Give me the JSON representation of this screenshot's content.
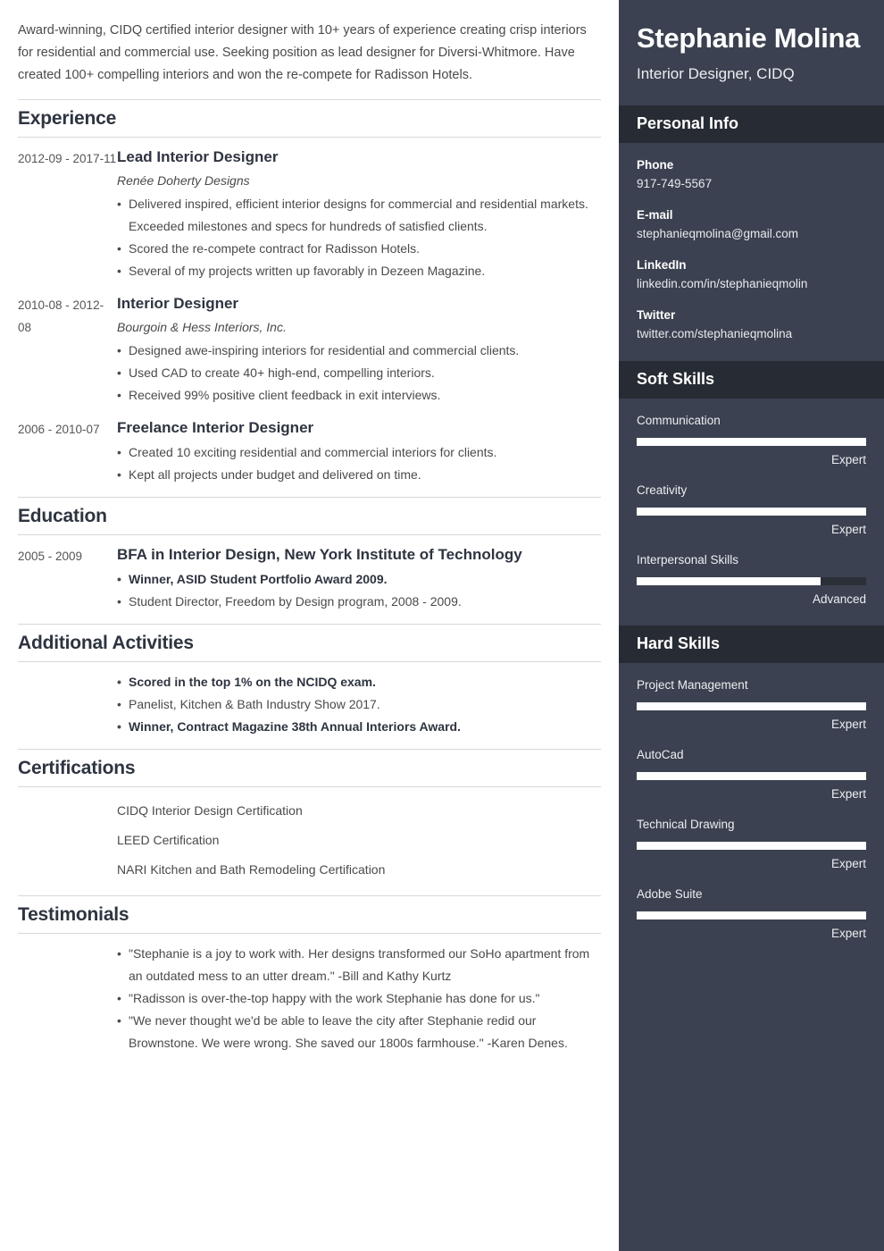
{
  "summary": "Award-winning, CIDQ certified interior designer with 10+ years of experience creating crisp interiors for residential and commercial use. Seeking position as lead designer for Diversi-Whitmore. Have created 100+ compelling interiors and won the re-compete for Radisson Hotels.",
  "sections": {
    "experience": {
      "heading": "Experience",
      "entries": [
        {
          "dates": "2012-09 - 2017-11",
          "title": "Lead Interior Designer",
          "company": "Renée Doherty Designs",
          "bullets": [
            {
              "text": "Delivered inspired, efficient interior designs for commercial and residential markets. Exceeded milestones and specs for hundreds of satisfied clients.",
              "bold": false
            },
            {
              "text": "Scored the re-compete contract for Radisson Hotels.",
              "bold": false
            },
            {
              "text": "Several of my projects written up favorably in Dezeen Magazine.",
              "bold": false
            }
          ]
        },
        {
          "dates": "2010-08 - 2012-08",
          "title": "Interior Designer",
          "company": "Bourgoin & Hess Interiors, Inc.",
          "bullets": [
            {
              "text": "Designed awe-inspiring interiors for residential and commercial clients.",
              "bold": false
            },
            {
              "text": "Used CAD to create 40+ high-end, compelling interiors.",
              "bold": false
            },
            {
              "text": "Received 99% positive client feedback in exit interviews.",
              "bold": false
            }
          ]
        },
        {
          "dates": "2006 - 2010-07",
          "title": "Freelance Interior Designer",
          "company": "",
          "bullets": [
            {
              "text": "Created 10 exciting residential and commercial interiors for clients.",
              "bold": false
            },
            {
              "text": "Kept all projects under budget and delivered on time.",
              "bold": false
            }
          ]
        }
      ]
    },
    "education": {
      "heading": "Education",
      "entries": [
        {
          "dates": "2005 - 2009",
          "title": "BFA in Interior Design, New York Institute of Technology",
          "company": "",
          "bullets": [
            {
              "text": "Winner, ASID Student Portfolio Award 2009.",
              "bold": true
            },
            {
              "text": "Student Director, Freedom by Design program, 2008 - 2009.",
              "bold": false
            }
          ]
        }
      ]
    },
    "additional_activities": {
      "heading": "Additional Activities",
      "entries": [
        {
          "dates": "",
          "title": "",
          "company": "",
          "bullets": [
            {
              "text": "Scored in the top 1% on the NCIDQ exam.",
              "bold": true
            },
            {
              "text": "Panelist, Kitchen & Bath Industry Show 2017.",
              "bold": false
            },
            {
              "text": "Winner, Contract Magazine 38th Annual Interiors Award.",
              "bold": true
            }
          ]
        }
      ]
    },
    "certifications": {
      "heading": "Certifications",
      "items": [
        "CIDQ Interior Design Certification",
        "LEED Certification",
        "NARI Kitchen and Bath Remodeling Certification"
      ]
    },
    "testimonials": {
      "heading": "Testimonials",
      "entries": [
        {
          "dates": "",
          "title": "",
          "company": "",
          "bullets": [
            {
              "text": "\"Stephanie is a joy to work with. Her designs transformed our SoHo apartment from an outdated mess to an utter dream.\" -Bill and Kathy Kurtz",
              "bold": false
            },
            {
              "text": "\"Radisson is over-the-top happy with the work Stephanie has done for us.\"",
              "bold": false
            },
            {
              "text": "\"We never thought we'd be able to leave the city after Stephanie redid our Brownstone. We were wrong. She saved our 1800s farmhouse.\" -Karen Denes.",
              "bold": false
            }
          ]
        }
      ]
    }
  },
  "sidebar": {
    "name": "Stephanie Molina",
    "role": "Interior Designer, CIDQ",
    "personal_info": {
      "heading": "Personal Info",
      "items": [
        {
          "label": "Phone",
          "value": "917-749-5567"
        },
        {
          "label": "E-mail",
          "value": "stephanieqmolina@gmail.com"
        },
        {
          "label": "LinkedIn",
          "value": "linkedin.com/in/stephanieqmolin"
        },
        {
          "label": "Twitter",
          "value": "twitter.com/stephanieqmolina"
        }
      ]
    },
    "soft_skills": {
      "heading": "Soft Skills",
      "items": [
        {
          "name": "Communication",
          "level": "Expert",
          "percent": 100
        },
        {
          "name": "Creativity",
          "level": "Expert",
          "percent": 100
        },
        {
          "name": "Interpersonal Skills",
          "level": "Advanced",
          "percent": 80
        }
      ]
    },
    "hard_skills": {
      "heading": "Hard Skills",
      "items": [
        {
          "name": "Project Management",
          "level": "Expert",
          "percent": 100
        },
        {
          "name": "AutoCad",
          "level": "Expert",
          "percent": 100
        },
        {
          "name": "Technical Drawing",
          "level": "Expert",
          "percent": 100
        },
        {
          "name": "Adobe Suite",
          "level": "Expert",
          "percent": 100
        }
      ]
    }
  },
  "colors": {
    "sidebar_bg": "#3b4150",
    "sidebar_band": "#272b33",
    "skill_track": "#2b2f38",
    "skill_fill": "#ffffff",
    "heading": "#2e3440",
    "body_text": "#4a4a4a",
    "rule": "#d8d8d8"
  }
}
